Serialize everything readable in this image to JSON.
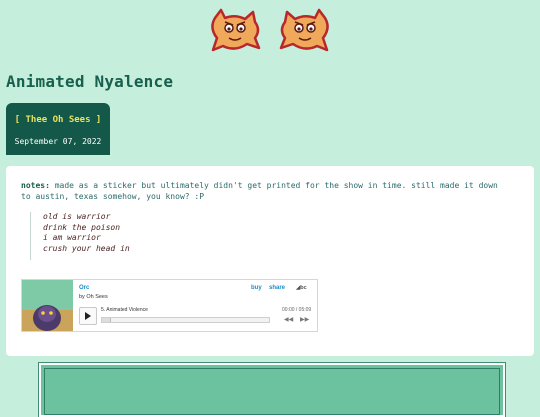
{
  "page": {
    "title": "Animated Nyalence"
  },
  "post": {
    "tag_label": "[ Thee Oh Sees ]",
    "date": "September 07, 2022",
    "notes_label": "notes:",
    "notes_text": " made as a sticker but ultimately didn't get printed for the show in time. still made it down to austin, texas somehow, you know? :P",
    "lyrics": [
      "old is warrior",
      "drink the poison",
      "i am warrior",
      "crush your head in"
    ]
  },
  "player": {
    "album_title": "Orc",
    "artist": "by Oh Sees",
    "buy_label": "buy",
    "share_label": "share",
    "logo_text": "bc",
    "track": "5. Animated Violence",
    "time": "00:00 / 05:09",
    "prev_icon": "prev-icon",
    "next_icon": "next-icon"
  },
  "colors": {
    "background": "#c6eedc",
    "title": "#17604d",
    "header_box": "#14584a",
    "tag": "#e8e35a",
    "link": "#1a8cc7"
  }
}
